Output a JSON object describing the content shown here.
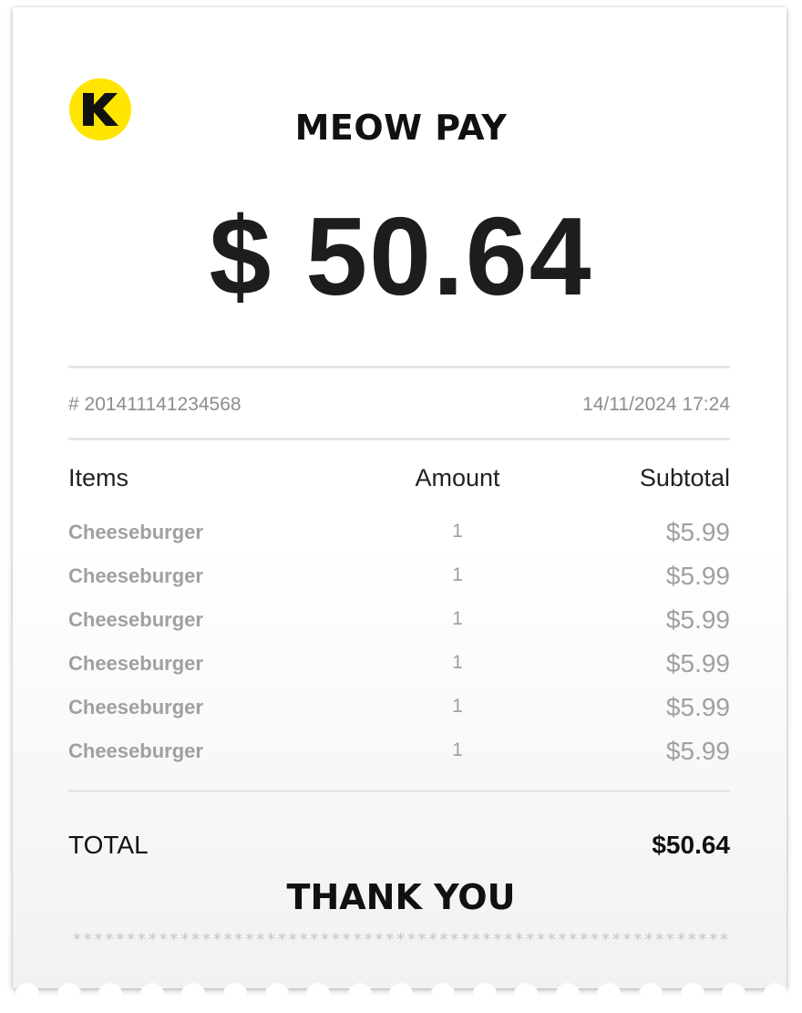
{
  "header": {
    "brand_name": "MEOW PAY",
    "logo_letter": "K",
    "amount": "$ 50.64"
  },
  "meta": {
    "transaction_id": "# 201411141234568",
    "datetime": "14/11/2024 17:24"
  },
  "table": {
    "columns": [
      "Items",
      "Amount",
      "Subtotal"
    ],
    "rows": [
      {
        "item": "Cheeseburger",
        "amount": "1",
        "subtotal": "$5.99"
      },
      {
        "item": "Cheeseburger",
        "amount": "1",
        "subtotal": "$5.99"
      },
      {
        "item": "Cheeseburger",
        "amount": "1",
        "subtotal": "$5.99"
      },
      {
        "item": "Cheeseburger",
        "amount": "1",
        "subtotal": "$5.99"
      },
      {
        "item": "Cheeseburger",
        "amount": "1",
        "subtotal": "$5.99"
      },
      {
        "item": "Cheeseburger",
        "amount": "1",
        "subtotal": "$5.99"
      }
    ]
  },
  "total": {
    "label": "TOTAL",
    "value": "$50.64"
  },
  "footer": {
    "thanks": "THANK YOU",
    "stars": "**************************************************************"
  },
  "colors": {
    "logo_yellow": "#ffe500",
    "text_dark": "#111111",
    "text_muted": "#a0a0a0",
    "rule": "#e6e6e9"
  }
}
